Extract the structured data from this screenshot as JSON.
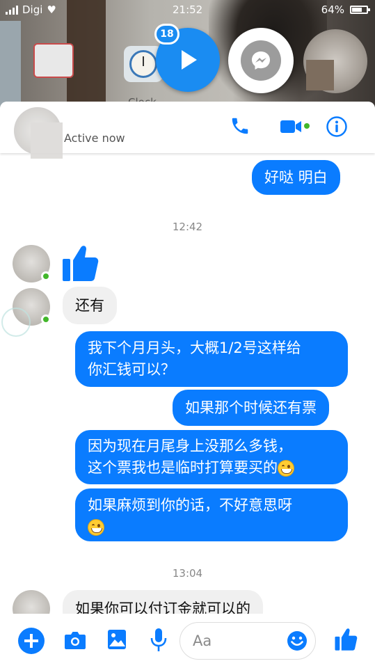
{
  "status_bar": {
    "carrier": "Digi",
    "time": "21:52",
    "battery": "64%"
  },
  "chat_heads": {
    "badge_count": "18"
  },
  "home_behind": {
    "app_label": "Clock"
  },
  "header": {
    "status": "Active now",
    "phone_icon": "phone-icon",
    "video_icon": "video-camera-icon",
    "info_icon": "info-icon"
  },
  "colors": {
    "accent": "#0a7cff",
    "incoming_bubble": "#f0f0f0",
    "online": "#42b72a"
  },
  "messages": [
    {
      "type": "outgoing",
      "text": "好哒 明白"
    },
    {
      "type": "timestamp",
      "text": "12:42"
    },
    {
      "type": "incoming",
      "kind": "like-sticker"
    },
    {
      "type": "incoming",
      "text": "还有"
    },
    {
      "type": "outgoing",
      "lines": [
        "我下个月月头，大概1/2号这样给",
        "你汇钱可以？"
      ]
    },
    {
      "type": "outgoing",
      "text": "如果那个时候还有票"
    },
    {
      "type": "outgoing",
      "lines": [
        "因为现在月尾身上没那么多钱，",
        "这个票我也是临时打算要买的"
      ],
      "emoji": "grinning-sweat"
    },
    {
      "type": "outgoing",
      "lines": [
        "如果麻烦到你的话，不好意思呀",
        ""
      ],
      "emoji": "grinning-sweat"
    },
    {
      "type": "timestamp",
      "text": "13:04"
    },
    {
      "type": "incoming",
      "text": "如果你可以付订金就可以的"
    }
  ],
  "composer": {
    "placeholder": "Aa",
    "buttons": [
      "plus-icon",
      "camera-icon",
      "image-icon",
      "microphone-icon",
      "emoji-icon",
      "like-icon"
    ]
  }
}
